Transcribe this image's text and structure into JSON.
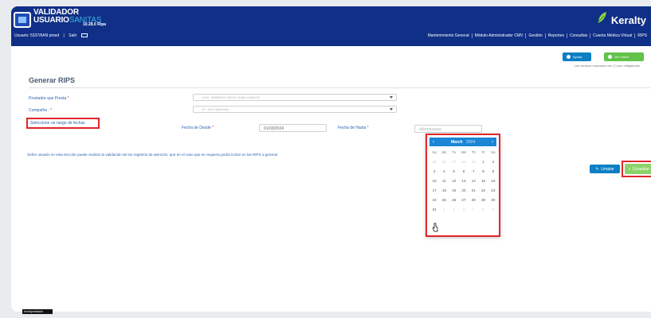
{
  "header": {
    "logo_line1": "VALIDADOR",
    "logo_line2_a": "USUARIO",
    "logo_line2_b": "SANITAS",
    "version": "10.28.0 Ripa",
    "brand": "Keralty",
    "brand_color": "#ffffff",
    "bar_color": "#102f86"
  },
  "userbar": {
    "user": "Usuario: 5337/6AN pmed",
    "exit": "Salir"
  },
  "nav": [
    "Mantenimiento General",
    "Módulo Administrador CMV",
    "Gestión",
    "Reportes",
    "Consultas",
    "Cuenta Médica Virtual",
    "RIPS"
  ],
  "actions": {
    "ayuda": "Ayuda",
    "volver": "Ver Volver",
    "required_note": "Los campos marcados con (*) son obligatorios"
  },
  "form": {
    "title": "Generar RIPS",
    "prestador_label": "Prestador que Presta",
    "prestador_value": "1234 - BARRIOS PINTO JUAN CARLOS",
    "compania_label": "Compañía :",
    "compania_value": "10 - EPS SANITAS",
    "range_label": "Seleccione un rango de fechas",
    "desde_label": "Fecha de Desde",
    "desde_value": "01/03/2024",
    "hasta_label": "Fecha de Hasta",
    "hasta_placeholder": "dd/mm/aaaa",
    "required_mark": "*",
    "notice": "Señor usuario en esta sección puede realizar la validación de los registros de atención, que en el caso que se requiera podrá incluir en los RIPS a generar",
    "limpiar": "Limpiar",
    "consultar": "Consultar"
  },
  "calendar": {
    "month": "March",
    "year": "2024",
    "prev": "‹",
    "next": "›",
    "weekdays": [
      "Su",
      "Mo",
      "Tu",
      "We",
      "Th",
      "Fr",
      "Sa"
    ],
    "days": [
      {
        "d": "25",
        "muted": true
      },
      {
        "d": "26",
        "muted": true
      },
      {
        "d": "27",
        "muted": true
      },
      {
        "d": "28",
        "muted": true
      },
      {
        "d": "29",
        "muted": true
      },
      {
        "d": "1",
        "muted": false
      },
      {
        "d": "2",
        "muted": false
      },
      {
        "d": "3",
        "muted": false
      },
      {
        "d": "4",
        "muted": false
      },
      {
        "d": "5",
        "muted": false
      },
      {
        "d": "6",
        "muted": false
      },
      {
        "d": "7",
        "muted": false
      },
      {
        "d": "8",
        "muted": false
      },
      {
        "d": "9",
        "muted": false
      },
      {
        "d": "10",
        "muted": false
      },
      {
        "d": "11",
        "muted": false
      },
      {
        "d": "12",
        "muted": false
      },
      {
        "d": "13",
        "muted": false
      },
      {
        "d": "14",
        "muted": false
      },
      {
        "d": "15",
        "muted": false
      },
      {
        "d": "16",
        "muted": false
      },
      {
        "d": "17",
        "muted": false
      },
      {
        "d": "18",
        "muted": false
      },
      {
        "d": "19",
        "muted": false
      },
      {
        "d": "20",
        "muted": false
      },
      {
        "d": "21",
        "muted": false
      },
      {
        "d": "22",
        "muted": false
      },
      {
        "d": "23",
        "muted": false
      },
      {
        "d": "24",
        "muted": false
      },
      {
        "d": "25",
        "muted": false
      },
      {
        "d": "26",
        "muted": false
      },
      {
        "d": "27",
        "muted": false
      },
      {
        "d": "28",
        "muted": false
      },
      {
        "d": "29",
        "muted": false
      },
      {
        "d": "30",
        "muted": false
      },
      {
        "d": "31",
        "muted": false
      },
      {
        "d": "1",
        "muted": true
      },
      {
        "d": "2",
        "muted": true
      },
      {
        "d": "3",
        "muted": true
      },
      {
        "d": "4",
        "muted": true
      },
      {
        "d": "5",
        "muted": true
      },
      {
        "d": "6",
        "muted": true
      }
    ]
  },
  "footer": {
    "label": "Keraltyvalidador"
  }
}
